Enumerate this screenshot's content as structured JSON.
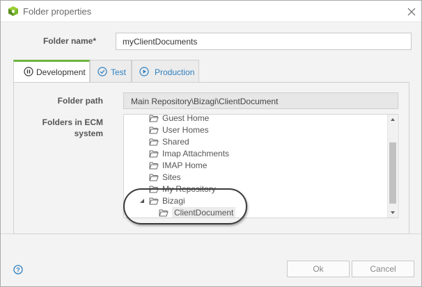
{
  "window": {
    "title": "Folder properties"
  },
  "form": {
    "folder_name_label": "Folder name*",
    "folder_name_value": "myClientDocuments"
  },
  "tabs": [
    {
      "label": "Development",
      "active": true
    },
    {
      "label": "Test",
      "active": false
    },
    {
      "label": "Production",
      "active": false
    }
  ],
  "development": {
    "folder_path_label": "Folder path",
    "folder_path_value": "Main Repository\\Bizagi\\ClientDocument",
    "ecm_label_line1": "Folders in ECM",
    "ecm_label_line2": "system",
    "tree": [
      {
        "label": "Guest Home",
        "level": 1
      },
      {
        "label": "User Homes",
        "level": 1
      },
      {
        "label": "Shared",
        "level": 1
      },
      {
        "label": "Imap Attachments",
        "level": 1
      },
      {
        "label": "IMAP Home",
        "level": 1
      },
      {
        "label": "Sites",
        "level": 1
      },
      {
        "label": "My Repository",
        "level": 1
      },
      {
        "label": "Bizagi",
        "level": 1,
        "expanded": true
      },
      {
        "label": "ClientDocument",
        "level": 2,
        "selected": true
      }
    ]
  },
  "footer": {
    "ok_label": "Ok",
    "cancel_label": "Cancel"
  },
  "colors": {
    "active_tab_accent": "#6db33f",
    "tab_link": "#2f7fc0",
    "highlight_circle": "#3a3a3a"
  },
  "icons": {
    "title": "bizagi-cube-icon",
    "close": "close-icon",
    "development_tab": "pause-circle-icon",
    "test_tab": "check-circle-icon",
    "production_tab": "play-circle-icon",
    "folder": "folder-open-icon",
    "help": "help-icon"
  }
}
